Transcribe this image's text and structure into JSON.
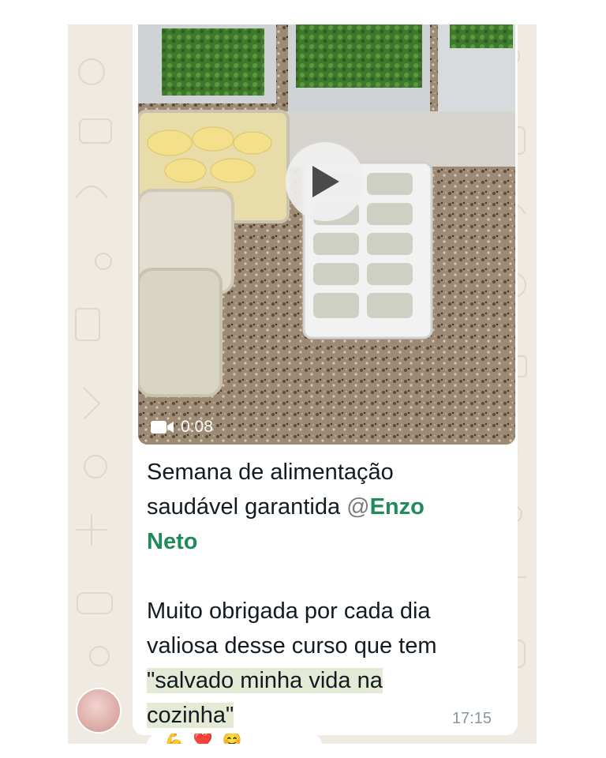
{
  "message": {
    "video": {
      "duration": "0:08",
      "play_icon": "play-icon",
      "camera_icon": "video-camera-icon"
    },
    "caption": {
      "line1": "Semana de alimentação",
      "line2_text": "saudável  garantida ",
      "mention_at": "@",
      "mention_line2": "Enzo",
      "mention_line3": "Neto",
      "para2_line1": "Muito  obrigada  por cada dia",
      "para2_line2": "valiosa desse curso  que tem",
      "para2_line3": "\"salvado  minha vida na ",
      "para2_line4": "cozinha\""
    },
    "timestamp": "17:15",
    "reactions": [
      "💪",
      "❤️",
      "😊"
    ]
  },
  "colors": {
    "chat_background": "#efeae2",
    "bubble": "#ffffff",
    "mention": "#1f8a5a",
    "highlight": "#e4ead6",
    "timestamp": "#8696a0"
  }
}
